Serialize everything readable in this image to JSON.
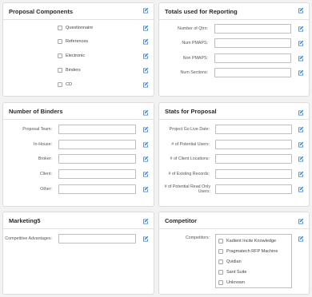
{
  "proposal_components": {
    "title": "Proposal Components",
    "items": [
      "Questionnaire",
      "References",
      "Electronic",
      "Binders",
      "CD"
    ]
  },
  "totals_reporting": {
    "title": "Totals used for Reporting",
    "fields": [
      {
        "label": "Number of Qtrn:",
        "value": ""
      },
      {
        "label": "Num PMAPS:",
        "value": ""
      },
      {
        "label": "Non PMAPS:",
        "value": ""
      },
      {
        "label": "Num Sections:",
        "value": ""
      }
    ]
  },
  "number_of_binders": {
    "title": "Number of Binders",
    "fields": [
      {
        "label": "Proposal Team:",
        "value": ""
      },
      {
        "label": "In-House:",
        "value": ""
      },
      {
        "label": "Broker:",
        "value": ""
      },
      {
        "label": "Client:",
        "value": ""
      },
      {
        "label": "Other:",
        "value": ""
      }
    ]
  },
  "stats_for_proposal": {
    "title": "Stats for Proposal",
    "fields": [
      {
        "label": "Project Go Live Date:",
        "value": ""
      },
      {
        "label": "# of Potential Users:",
        "value": ""
      },
      {
        "label": "# of Client Locations:",
        "value": ""
      },
      {
        "label": "# of Existing Records:",
        "value": ""
      },
      {
        "label": "# of Potential Read Only Users:",
        "value": ""
      }
    ]
  },
  "marketing": {
    "title": "Marketing5",
    "fields": [
      {
        "label": "Competitive Advantages:",
        "value": ""
      }
    ]
  },
  "competitor": {
    "title": "Competitor",
    "label": "Competitors:",
    "items": [
      "Kadient Incite Knowledge",
      "Pragmatech RFP Machine",
      "Qvidian",
      "Sant Suite",
      "Unknown"
    ]
  },
  "icons": {
    "edit": "edit-icon",
    "checkbox": "checkbox"
  },
  "colors": {
    "accent": "#2a7fd4",
    "panel_border": "#dcdcdc",
    "background": "#f2f2f2"
  }
}
